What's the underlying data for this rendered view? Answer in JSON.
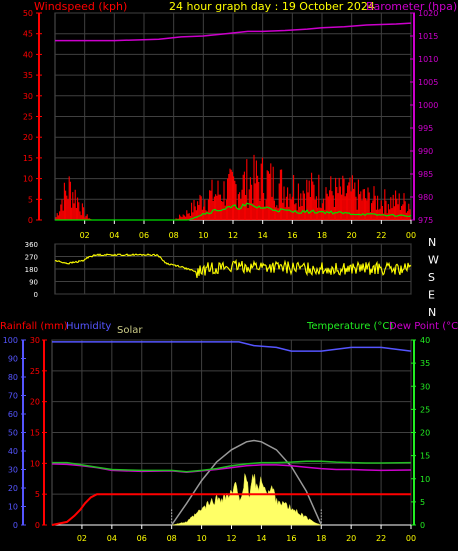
{
  "title": "24 hour graph day : 19 October 2024",
  "colors": {
    "wind": "#ff0000",
    "gust": "#ff0000",
    "avgwind": "#00e000",
    "baro": "#cc00cc",
    "dir": "#ffff00",
    "rain": "#ff0000",
    "humidity": "#5555ff",
    "solar": "#ffff66",
    "solarmax": "#999999",
    "temp": "#22bb22",
    "dew": "#cc00cc",
    "axis": "#ffffff",
    "grid": "#404040"
  },
  "chart_data": [
    {
      "type": "line",
      "title": "24 hour graph day : 19 October 2024",
      "x_ticks": [
        "02",
        "04",
        "06",
        "08",
        "10",
        "12",
        "14",
        "16",
        "18",
        "20",
        "22",
        "00"
      ],
      "left_axis": {
        "label": "Windspeed (kph)",
        "ylim": [
          0,
          50
        ],
        "ticks": [
          "0",
          "5",
          "10",
          "15",
          "20",
          "25",
          "30",
          "35",
          "40",
          "45",
          "50"
        ]
      },
      "right_axis": {
        "label": "Barometer (hpa)",
        "ylim": [
          975,
          1020
        ],
        "ticks": [
          "975",
          "980",
          "985",
          "990",
          "995",
          "1000",
          "1005",
          "1010",
          "1015",
          "1020"
        ]
      },
      "series": [
        {
          "name": "Barometer (hpa)",
          "axis": "right",
          "x": [
            0,
            4,
            7,
            8.5,
            10,
            11.5,
            13,
            14,
            15.5,
            17,
            18,
            19.5,
            21,
            22,
            23,
            24
          ],
          "y": [
            1014,
            1014,
            1014.3,
            1014.8,
            1015,
            1015.5,
            1016,
            1016,
            1016.2,
            1016.5,
            1016.8,
            1017,
            1017.4,
            1017.5,
            1017.6,
            1017.8
          ]
        }
      ]
    },
    {
      "type": "scatter",
      "right_axis_labels": [
        "N",
        "W",
        "S",
        "E",
        "N"
      ],
      "left_ticks": [
        "0",
        "90",
        "180",
        "270",
        "360"
      ],
      "ylim": [
        0,
        360
      ],
      "x_ticks": [
        "02",
        "04",
        "06",
        "08",
        "10",
        "12",
        "14",
        "16",
        "18",
        "20",
        "22",
        "00"
      ],
      "series": [
        {
          "name": "Wind direction",
          "axis": "left",
          "x": [
            0,
            0.9,
            1.9,
            2.3,
            2.9,
            6.9,
            7.5,
            8.4,
            9.6,
            10.5,
            12,
            13.5,
            15,
            17,
            19,
            21,
            23,
            24
          ],
          "y": [
            240,
            220,
            240,
            270,
            282,
            282,
            220,
            200,
            155,
            190,
            195,
            200,
            190,
            185,
            180,
            185,
            175,
            180
          ]
        }
      ]
    },
    {
      "type": "line",
      "legend": [
        "Rainfall (mm)",
        "Humidity",
        "Solar",
        "Temperature (°C)",
        "Dew Point (°C)"
      ],
      "x_ticks": [
        "02",
        "04",
        "06",
        "08",
        "10",
        "12",
        "14",
        "16",
        "18",
        "20",
        "22",
        "00"
      ],
      "rain_axis": {
        "ylim": [
          0,
          30
        ],
        "ticks": [
          "0",
          "5",
          "10",
          "15",
          "20",
          "25",
          "30"
        ]
      },
      "humidity_axis": {
        "ylim": [
          0,
          100
        ],
        "ticks": [
          "0",
          "10",
          "20",
          "30",
          "40",
          "50",
          "60",
          "70",
          "80",
          "90",
          "100"
        ]
      },
      "temp_axis": {
        "ylim": [
          0,
          40
        ],
        "ticks": [
          "0",
          "5",
          "10",
          "15",
          "20",
          "25",
          "30",
          "35",
          "40"
        ]
      },
      "series": [
        {
          "name": "Humidity",
          "axis": "humidity",
          "x": [
            0,
            5,
            9,
            10,
            10.5,
            12.5,
            13.5,
            15,
            16,
            16.5,
            18,
            19,
            20,
            22,
            23,
            24
          ],
          "y": [
            99,
            99,
            99,
            99,
            99,
            99,
            97,
            96,
            94,
            94,
            94,
            95,
            96,
            96,
            95,
            94
          ]
        },
        {
          "name": "Rainfall (mm)",
          "axis": "rain",
          "x": [
            0,
            1,
            1.5,
            1.9,
            2.2,
            2.6,
            3,
            4,
            24
          ],
          "y": [
            0,
            0.5,
            1.5,
            2.5,
            3.5,
            4.5,
            5,
            5,
            5
          ]
        },
        {
          "name": "Temperature (°C)",
          "axis": "temp",
          "x": [
            0,
            1,
            2,
            3,
            4,
            6,
            8,
            9,
            10,
            11,
            12,
            13,
            14,
            15,
            16,
            17,
            18,
            19,
            20,
            21,
            22,
            24
          ],
          "y": [
            13.5,
            13.5,
            13,
            12.5,
            12,
            11.8,
            11.8,
            11.5,
            11.8,
            12.2,
            12.8,
            13.2,
            13.5,
            13.5,
            13.6,
            13.8,
            13.8,
            13.6,
            13.5,
            13.4,
            13.4,
            13.5
          ]
        },
        {
          "name": "Dew Point (°C)",
          "axis": "temp",
          "x": [
            0,
            1,
            2,
            3,
            4,
            6,
            8,
            9,
            10,
            11,
            12,
            13,
            14,
            15,
            16,
            17,
            18,
            19,
            20,
            21,
            22,
            24
          ],
          "y": [
            13.2,
            13.1,
            12.8,
            12.4,
            11.8,
            11.6,
            11.7,
            11.4,
            11.7,
            12.0,
            12.4,
            12.8,
            13.0,
            13.0,
            12.8,
            12.5,
            12.2,
            12.0,
            12.0,
            11.9,
            11.8,
            11.9
          ]
        },
        {
          "name": "Solar",
          "axis": "rain",
          "x": [
            8,
            9,
            9.5,
            10,
            10.5,
            11,
            11.5,
            12,
            12.3,
            12.6,
            12.9,
            13.2,
            13.5,
            13.8,
            14.1,
            14.4,
            14.7,
            15,
            15.5,
            16,
            16.5,
            17,
            17.5,
            18
          ],
          "y": [
            0,
            0.5,
            1.5,
            2.5,
            3.5,
            4.2,
            4.6,
            5.0,
            6.2,
            4.5,
            7.2,
            5.0,
            8.3,
            5.5,
            7.8,
            4.8,
            6.0,
            4.2,
            3.4,
            2.6,
            2.0,
            1.2,
            0.5,
            0
          ]
        },
        {
          "name": "Solar max",
          "axis": "rain",
          "x": [
            8,
            9,
            10,
            11,
            12,
            13,
            13.5,
            14,
            15,
            16,
            17,
            18
          ],
          "y": [
            0,
            3.5,
            7.2,
            10.2,
            12.2,
            13.5,
            13.7,
            13.5,
            12.2,
            9.5,
            5.5,
            0
          ]
        }
      ]
    }
  ]
}
